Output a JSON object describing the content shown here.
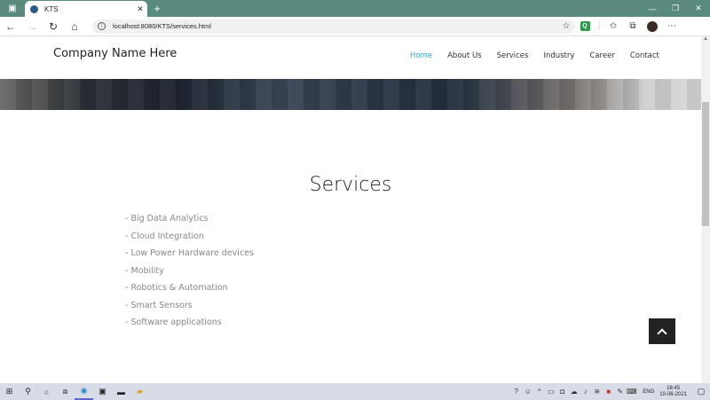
{
  "browser": {
    "tab_title": "KTS",
    "tab_close": "✕",
    "new_tab": "+",
    "url": "localhost:8080/KTS/services.html",
    "window_controls": [
      "—",
      "❐",
      "✕"
    ]
  },
  "site": {
    "brand": "Company Name Here",
    "nav": [
      "Home",
      "About Us",
      "Services",
      "Industry",
      "Career",
      "Contact"
    ],
    "active_nav": "Home"
  },
  "main": {
    "title": "Services",
    "services": [
      "- Big Data Analytics",
      "- Cloud Integration",
      "- Low Power Hardware devices",
      "- Mobility",
      "- Robotics & Automation",
      "- Smart Sensors",
      "- Software applications"
    ]
  },
  "taskbar": {
    "language": "ENG",
    "time": "18:45",
    "date": "10-06-2021"
  },
  "colors": {
    "tabstrip": "#5a8a7d",
    "nav_active": "#2aa9d6",
    "service_text": "#888888",
    "scroll_top_button": "#222222"
  }
}
